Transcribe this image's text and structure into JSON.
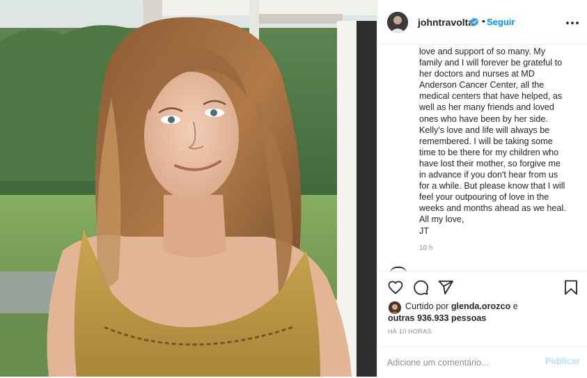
{
  "post": {
    "username": "johntravolta",
    "follow_label": "Seguir",
    "separator": "•",
    "icons": {
      "verified": "verified-badge-icon",
      "more": "more-options-icon",
      "like": "heart-icon",
      "comment": "comment-icon",
      "share": "share-icon",
      "save": "bookmark-icon"
    },
    "caption_lines": [
      "love and support of so many.  My",
      "family and I will forever be grateful to",
      "her doctors and nurses at MD",
      "Anderson Cancer Center, all the",
      "medical centers that have helped, as",
      "well as her many friends and loved",
      "ones who have been by her side.",
      "Kelly's love and life will always be",
      "remembered. I will be taking some",
      "time to be there for my children who",
      "have lost their mother, so forgive me",
      "in advance if you don't hear from us",
      "for a while.  But please know that I will",
      "feel your outpouring of love in the",
      "weeks and months ahead as we heal.",
      "All my love,",
      "JT"
    ],
    "caption_time": "10 h",
    "likes": {
      "prefix": "Curtido por",
      "user": "glenda.orozco",
      "and": "e",
      "others_prefix": "outras",
      "count": "936.933",
      "others_suffix": "pessoas"
    },
    "posted_ago": "HÁ 10 HORAS",
    "comment_placeholder": "Adicione um comentário...",
    "publish_label": "Publicar",
    "colors": {
      "accent": "#0095f6",
      "publish_disabled": "#b2dffc",
      "text": "#262626",
      "muted": "#8e8e8e"
    }
  }
}
